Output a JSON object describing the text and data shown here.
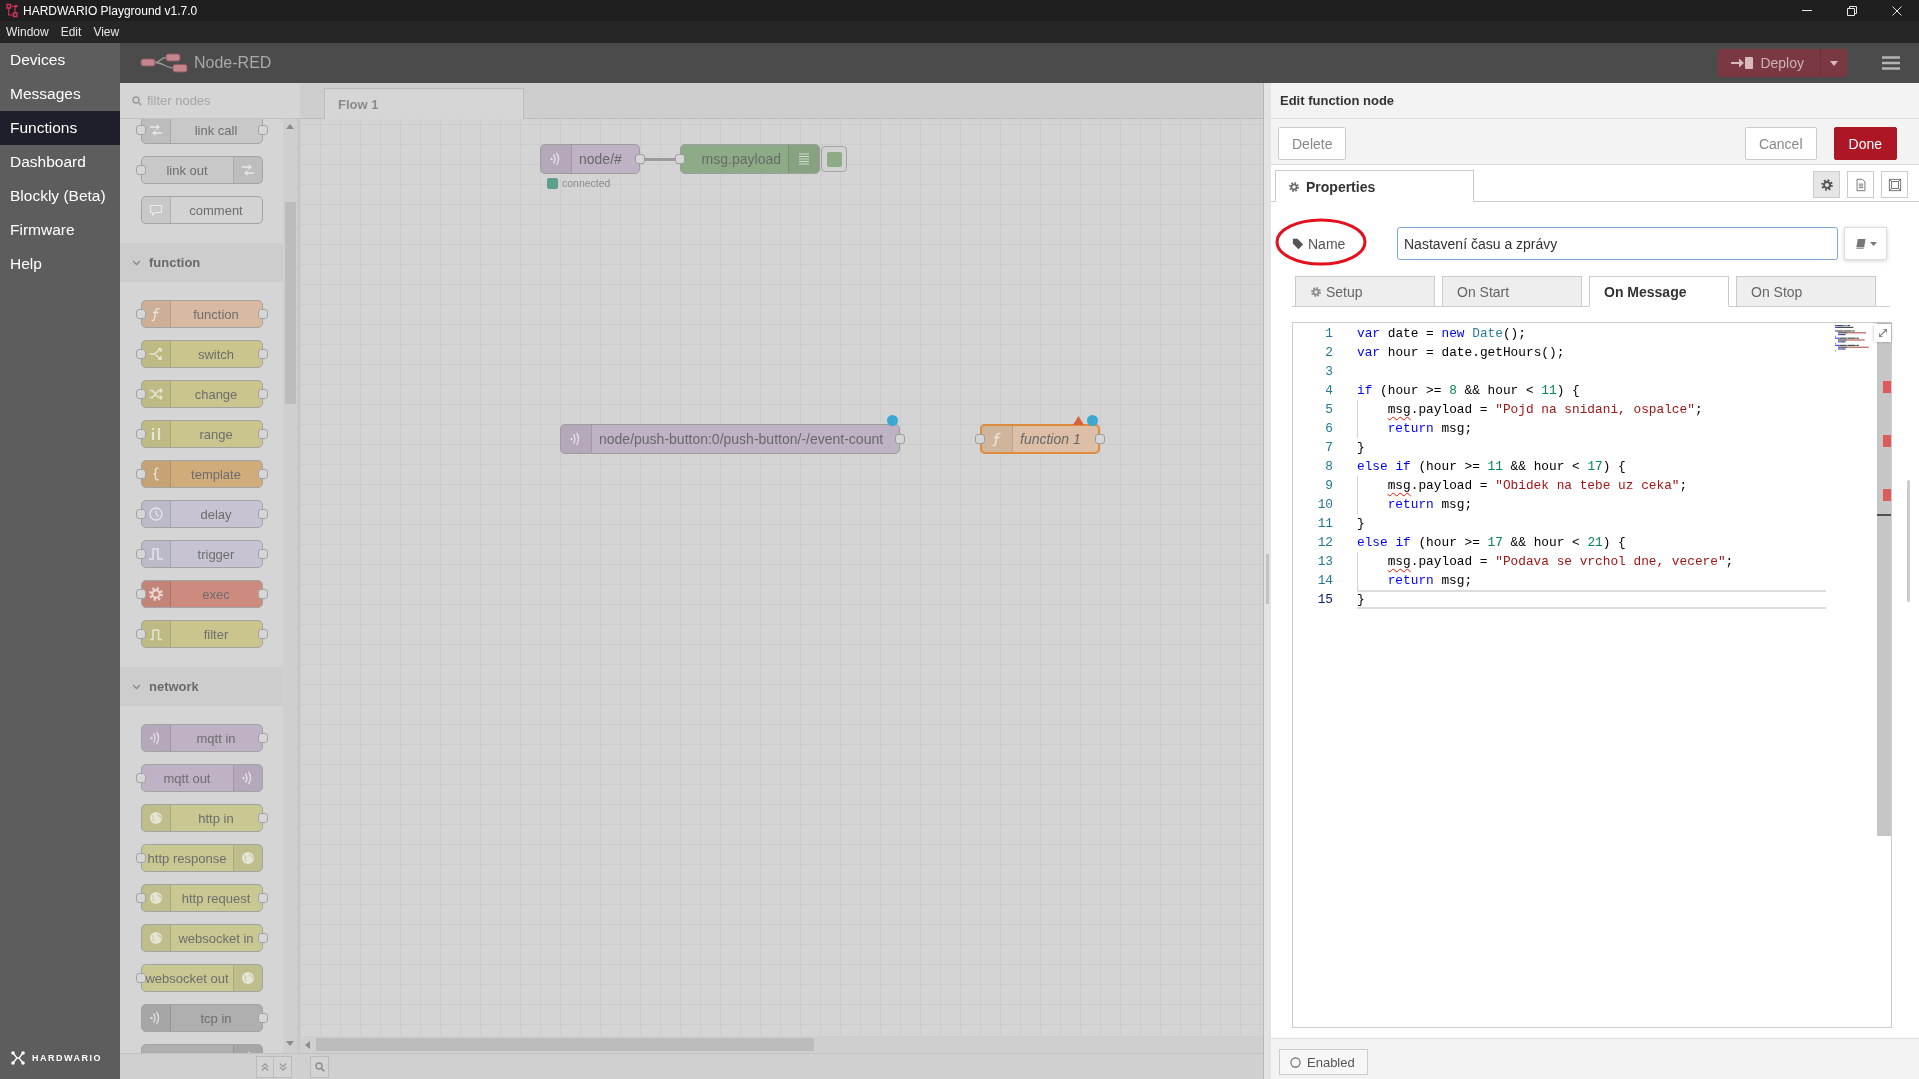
{
  "window": {
    "title": "HARDWARIO Playground v1.7.0",
    "menu": [
      "Window",
      "Edit",
      "View"
    ]
  },
  "sidebar": {
    "items": [
      {
        "label": "Devices",
        "selected": false
      },
      {
        "label": "Messages",
        "selected": false
      },
      {
        "label": "Functions",
        "selected": true
      },
      {
        "label": "Dashboard",
        "selected": false
      },
      {
        "label": "Blockly (Beta)",
        "selected": false
      },
      {
        "label": "Firmware",
        "selected": false
      },
      {
        "label": "Help",
        "selected": false
      }
    ],
    "brand": "HARDWARIO"
  },
  "header": {
    "title": "Node-RED",
    "deploy": {
      "label": "Deploy"
    }
  },
  "palette": {
    "filter": {
      "placeholder": "filter nodes"
    },
    "items": [
      {
        "kind": "node",
        "label": "link call",
        "color": "#c8c8c8",
        "input": true,
        "output": true,
        "icon_right": false
      },
      {
        "kind": "node",
        "label": "link out",
        "color": "#c8c8c8",
        "input": true,
        "output": false,
        "icon_right": true
      },
      {
        "kind": "node",
        "label": "comment",
        "color": "#d3d3d3",
        "input": false,
        "output": false,
        "icon_right": false
      },
      {
        "kind": "category",
        "label": "function",
        "expanded": true
      },
      {
        "kind": "node",
        "label": "function",
        "color": "#d8b9a1",
        "input": true,
        "output": true,
        "icon_right": false
      },
      {
        "kind": "node",
        "label": "switch",
        "color": "#c9c58c",
        "input": true,
        "output": true,
        "icon_right": false
      },
      {
        "kind": "node",
        "label": "change",
        "color": "#c9c58c",
        "input": true,
        "output": true,
        "icon_right": false
      },
      {
        "kind": "node",
        "label": "range",
        "color": "#c9c58c",
        "input": true,
        "output": true,
        "icon_right": false
      },
      {
        "kind": "node",
        "label": "template",
        "color": "#d1ac7b",
        "input": true,
        "output": true,
        "icon_right": false
      },
      {
        "kind": "node",
        "label": "delay",
        "color": "#c7c3d3",
        "input": true,
        "output": true,
        "icon_right": false
      },
      {
        "kind": "node",
        "label": "trigger",
        "color": "#c7c3d3",
        "input": true,
        "output": true,
        "icon_right": false
      },
      {
        "kind": "node",
        "label": "exec",
        "color": "#cd8b7f",
        "input": true,
        "output": true,
        "icon_right": false
      },
      {
        "kind": "node",
        "label": "filter",
        "color": "#c9c58c",
        "input": true,
        "output": true,
        "icon_right": false
      },
      {
        "kind": "category",
        "label": "network",
        "expanded": true
      },
      {
        "kind": "node",
        "label": "mqtt in",
        "color": "#bfb2c5",
        "input": false,
        "output": true,
        "icon_right": false
      },
      {
        "kind": "node",
        "label": "mqtt out",
        "color": "#bfb2c5",
        "input": true,
        "output": false,
        "icon_right": true
      },
      {
        "kind": "node",
        "label": "http in",
        "color": "#c9c893",
        "input": false,
        "output": true,
        "icon_right": false
      },
      {
        "kind": "node",
        "label": "http response",
        "color": "#c9c893",
        "input": true,
        "output": false,
        "icon_right": true
      },
      {
        "kind": "node",
        "label": "http request",
        "color": "#c9c893",
        "input": true,
        "output": true,
        "icon_right": false
      },
      {
        "kind": "node",
        "label": "websocket in",
        "color": "#c9c893",
        "input": false,
        "output": true,
        "icon_right": false
      },
      {
        "kind": "node",
        "label": "websocket out",
        "color": "#c9c893",
        "input": true,
        "output": false,
        "icon_right": true
      },
      {
        "kind": "node",
        "label": "tcp in",
        "color": "#afafaf",
        "input": false,
        "output": true,
        "icon_right": false
      },
      {
        "kind": "node",
        "color": "#afafaf",
        "icon_right": true
      }
    ]
  },
  "workspace": {
    "tabs": [
      {
        "label": "Flow 1",
        "selected": true
      }
    ],
    "nodes": [
      {
        "label": "node/#",
        "color": "#bfb2c5",
        "icon_right": false,
        "input": false,
        "output": true,
        "output_wired": true,
        "selected": false,
        "changed": false,
        "invalid": false,
        "italic": false,
        "status": {
          "text": "connected",
          "color": "#5e9e8c"
        }
      },
      {
        "label": "msg.payload",
        "color": "#8eab88",
        "icon_right": true,
        "input": true,
        "output": false,
        "output_wired": false,
        "selected": false,
        "changed": false,
        "invalid": false,
        "italic": false,
        "button": {
          "on": true
        }
      },
      {
        "label": "node/push-button:0/push-button/-/event-count",
        "color": "#bfb2c5",
        "icon_right": false,
        "input": false,
        "output": true,
        "output_wired": false,
        "selected": false,
        "changed": true,
        "invalid": false,
        "italic": false
      },
      {
        "label": "function 1",
        "color": "#dcbfa6",
        "icon_right": false,
        "input": true,
        "output": true,
        "output_wired": false,
        "selected": true,
        "changed": true,
        "invalid": true,
        "italic": true
      }
    ]
  },
  "tray": {
    "title": "Edit function node",
    "left_actions": [
      {
        "label": "Delete",
        "kind": "plain"
      }
    ],
    "right_actions": [
      {
        "label": "Cancel",
        "kind": "plain"
      },
      {
        "label": "Done",
        "kind": "primary"
      }
    ],
    "tabs": [
      {
        "label": "Properties",
        "selected": true
      }
    ],
    "view_buttons": [
      {
        "selected": true
      },
      {
        "selected": false
      },
      {
        "selected": false
      }
    ],
    "name": {
      "label": "Name",
      "value": "Nastavení času a zprávy",
      "focused": true,
      "circled": true
    },
    "code_tabs": [
      {
        "label": "Setup",
        "selected": false
      },
      {
        "label": "On Start",
        "selected": false
      },
      {
        "label": "On Message",
        "selected": true
      },
      {
        "label": "On Stop",
        "selected": false
      }
    ],
    "editor": {
      "lines": [
        {
          "number": "1",
          "indented": false,
          "current": false,
          "tokens": [
            {
              "kind": "keyword",
              "text": "var"
            },
            {
              "kind": "plain",
              "text": " date = "
            },
            {
              "kind": "keyword",
              "text": "new"
            },
            {
              "kind": "type",
              "text": " Date"
            },
            {
              "kind": "plain",
              "text": "();"
            }
          ]
        },
        {
          "number": "2",
          "indented": false,
          "current": false,
          "tokens": [
            {
              "kind": "keyword",
              "text": "var"
            },
            {
              "kind": "plain",
              "text": " hour = date.getHours();"
            }
          ]
        },
        {
          "number": "3",
          "indented": false,
          "current": false
        },
        {
          "number": "4",
          "indented": false,
          "current": false,
          "tokens": [
            {
              "kind": "keyword",
              "text": "if"
            },
            {
              "kind": "plain",
              "text": " (hour >= "
            },
            {
              "kind": "number",
              "text": "8"
            },
            {
              "kind": "plain",
              "text": " && hour < "
            },
            {
              "kind": "number",
              "text": "11"
            },
            {
              "kind": "plain",
              "text": ") {"
            }
          ]
        },
        {
          "number": "5",
          "indented": true,
          "current": false,
          "tokens": [
            {
              "kind": "warning",
              "text": "msg"
            },
            {
              "kind": "plain",
              "text": ".payload = "
            },
            {
              "kind": "string",
              "text": "\"Pojd na snidani, ospalce\""
            },
            {
              "kind": "plain",
              "text": ";"
            }
          ]
        },
        {
          "number": "6",
          "indented": true,
          "current": false,
          "tokens": [
            {
              "kind": "keyword",
              "text": "return"
            },
            {
              "kind": "plain",
              "text": " msg;"
            }
          ]
        },
        {
          "number": "7",
          "indented": false,
          "current": false,
          "tokens": [
            {
              "kind": "plain",
              "text": "}"
            }
          ]
        },
        {
          "number": "8",
          "indented": false,
          "current": false,
          "tokens": [
            {
              "kind": "keyword",
              "text": "else if"
            },
            {
              "kind": "plain",
              "text": " (hour >= "
            },
            {
              "kind": "number",
              "text": "11"
            },
            {
              "kind": "plain",
              "text": " && hour < "
            },
            {
              "kind": "number",
              "text": "17"
            },
            {
              "kind": "plain",
              "text": ") {"
            }
          ]
        },
        {
          "number": "9",
          "indented": true,
          "current": false,
          "tokens": [
            {
              "kind": "warning",
              "text": "msg"
            },
            {
              "kind": "plain",
              "text": ".payload = "
            },
            {
              "kind": "string",
              "text": "\"Obidek na tebe uz ceka\""
            },
            {
              "kind": "plain",
              "text": ";"
            }
          ]
        },
        {
          "number": "10",
          "indented": true,
          "current": false,
          "tokens": [
            {
              "kind": "keyword",
              "text": "return"
            },
            {
              "kind": "plain",
              "text": " msg;"
            }
          ]
        },
        {
          "number": "11",
          "indented": false,
          "current": false,
          "tokens": [
            {
              "kind": "plain",
              "text": "}"
            }
          ]
        },
        {
          "number": "12",
          "indented": false,
          "current": false,
          "tokens": [
            {
              "kind": "keyword",
              "text": "else if"
            },
            {
              "kind": "plain",
              "text": " (hour >= "
            },
            {
              "kind": "number",
              "text": "17"
            },
            {
              "kind": "plain",
              "text": " && hour < "
            },
            {
              "kind": "number",
              "text": "21"
            },
            {
              "kind": "plain",
              "text": ") {"
            }
          ]
        },
        {
          "number": "13",
          "indented": true,
          "current": false,
          "tokens": [
            {
              "kind": "warning",
              "text": "msg"
            },
            {
              "kind": "plain",
              "text": ".payload = "
            },
            {
              "kind": "string",
              "text": "\"Podava se vrchol dne, vecere\""
            },
            {
              "kind": "plain",
              "text": ";"
            }
          ]
        },
        {
          "number": "14",
          "indented": true,
          "current": false,
          "tokens": [
            {
              "kind": "keyword",
              "text": "return"
            },
            {
              "kind": "plain",
              "text": " msg;"
            }
          ]
        },
        {
          "number": "15",
          "indented": false,
          "current": true,
          "tokens": [
            {
              "kind": "plain",
              "text": "}"
            }
          ]
        }
      ]
    },
    "enabled": {
      "label": "Enabled",
      "on": true
    }
  }
}
